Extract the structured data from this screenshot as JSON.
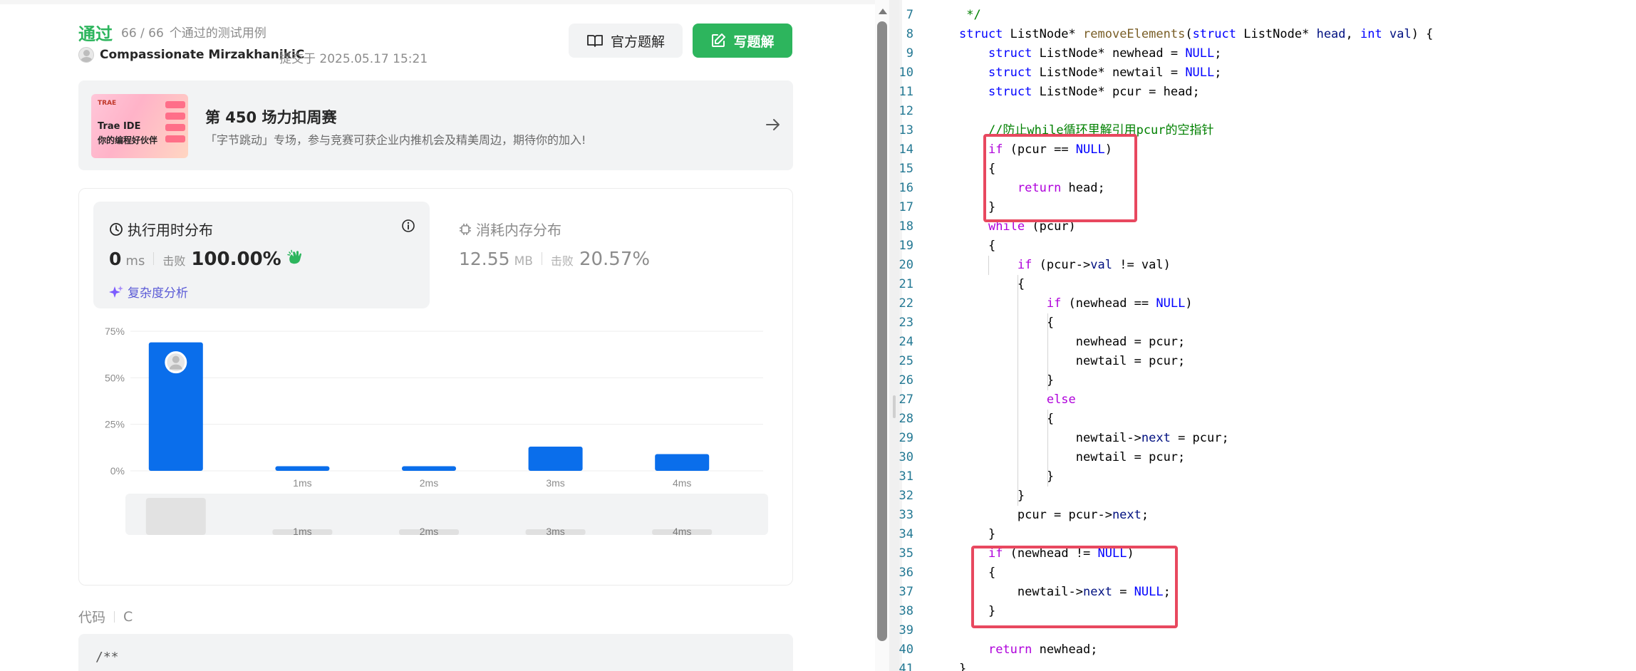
{
  "left": {
    "status": "通过",
    "passed": "66 / 66",
    "passed_suffix": "个通过的测试用例",
    "author": "Compassionate MirzakhanikiC",
    "submitted": "提交于 2025.05.17 15:21",
    "btn_official": "官方题解",
    "btn_write": "写题解",
    "banner": {
      "img_brand": "TRAE",
      "img_line1": "Trae IDE",
      "img_line2": "你的编程好伙伴",
      "title": "第 450 场力扣周赛",
      "subtitle": "「字节跳动」专场，参与竞赛可获企业内推机会及精美周边，期待你的加入!"
    },
    "runtime": {
      "title": "执行用时分布",
      "value": "0",
      "unit": "ms",
      "beat_label": "击败",
      "beat_pct": "100.00%",
      "analysis": "复杂度分析"
    },
    "memory": {
      "title": "消耗内存分布",
      "value": "12.55",
      "unit": "MB",
      "beat_label": "击败",
      "beat_pct": "20.57%"
    },
    "code_label": "代码",
    "code_lang": "C",
    "code_preview": "/**"
  },
  "chart_data": {
    "type": "bar",
    "categories": [
      "",
      "1ms",
      "2ms",
      "3ms",
      "4ms"
    ],
    "values": [
      69,
      2.5,
      2.5,
      13,
      9
    ],
    "yticks": [
      "75%",
      "50%",
      "25%",
      "0%"
    ],
    "ylim": [
      0,
      75
    ],
    "bar_color": "#0a6eeb",
    "highlighted_category_index": 0,
    "grid": true
  },
  "editor": {
    "lines": [
      {
        "n": "7",
        "segs": [
          {
            "t": " */",
            "c": "cm"
          }
        ]
      },
      {
        "n": "8",
        "segs": [
          {
            "t": "struct",
            "c": "kw"
          },
          {
            "t": " ListNode* ",
            "c": "plain"
          },
          {
            "t": "removeElements",
            "c": "fn"
          },
          {
            "t": "(",
            "c": "plain"
          },
          {
            "t": "struct",
            "c": "kw"
          },
          {
            "t": " ListNode* ",
            "c": "plain"
          },
          {
            "t": "head",
            "c": "var"
          },
          {
            "t": ", ",
            "c": "plain"
          },
          {
            "t": "int",
            "c": "kw"
          },
          {
            "t": " ",
            "c": "plain"
          },
          {
            "t": "val",
            "c": "var"
          },
          {
            "t": ") {",
            "c": "plain"
          }
        ]
      },
      {
        "n": "9",
        "segs": [
          {
            "t": "    ",
            "c": "plain"
          },
          {
            "t": "struct",
            "c": "kw"
          },
          {
            "t": " ListNode* newhead = ",
            "c": "plain"
          },
          {
            "t": "NULL",
            "c": "kw"
          },
          {
            "t": ";",
            "c": "plain"
          }
        ]
      },
      {
        "n": "10",
        "segs": [
          {
            "t": "    ",
            "c": "plain"
          },
          {
            "t": "struct",
            "c": "kw"
          },
          {
            "t": " ListNode* newtail = ",
            "c": "plain"
          },
          {
            "t": "NULL",
            "c": "kw"
          },
          {
            "t": ";",
            "c": "plain"
          }
        ]
      },
      {
        "n": "11",
        "segs": [
          {
            "t": "    ",
            "c": "plain"
          },
          {
            "t": "struct",
            "c": "kw"
          },
          {
            "t": " ListNode* pcur = head;",
            "c": "plain"
          }
        ]
      },
      {
        "n": "12",
        "segs": []
      },
      {
        "n": "13",
        "segs": [
          {
            "t": "    //防止while循环里解引用pcur的空指针",
            "c": "cm"
          }
        ]
      },
      {
        "n": "14",
        "segs": [
          {
            "t": "    ",
            "c": "plain"
          },
          {
            "t": "if",
            "c": "ctl"
          },
          {
            "t": " (pcur == ",
            "c": "plain"
          },
          {
            "t": "NULL",
            "c": "kw"
          },
          {
            "t": ")",
            "c": "plain"
          }
        ]
      },
      {
        "n": "15",
        "segs": [
          {
            "t": "    {",
            "c": "plain"
          }
        ]
      },
      {
        "n": "16",
        "segs": [
          {
            "t": "        ",
            "c": "plain"
          },
          {
            "t": "return",
            "c": "ctl"
          },
          {
            "t": " head;",
            "c": "plain"
          }
        ]
      },
      {
        "n": "17",
        "segs": [
          {
            "t": "    }",
            "c": "plain"
          }
        ]
      },
      {
        "n": "18",
        "segs": [
          {
            "t": "    ",
            "c": "plain"
          },
          {
            "t": "while",
            "c": "ctl"
          },
          {
            "t": " (pcur)",
            "c": "plain"
          }
        ]
      },
      {
        "n": "19",
        "segs": [
          {
            "t": "    {",
            "c": "plain"
          }
        ]
      },
      {
        "n": "20",
        "segs": [
          {
            "t": "        ",
            "c": "plain"
          },
          {
            "t": "if",
            "c": "ctl"
          },
          {
            "t": " (pcur->",
            "c": "plain"
          },
          {
            "t": "val",
            "c": "var"
          },
          {
            "t": " != val)",
            "c": "plain"
          }
        ]
      },
      {
        "n": "21",
        "segs": [
          {
            "t": "        {",
            "c": "plain"
          }
        ]
      },
      {
        "n": "22",
        "segs": [
          {
            "t": "            ",
            "c": "plain"
          },
          {
            "t": "if",
            "c": "ctl"
          },
          {
            "t": " (newhead == ",
            "c": "plain"
          },
          {
            "t": "NULL",
            "c": "kw"
          },
          {
            "t": ")",
            "c": "plain"
          }
        ]
      },
      {
        "n": "23",
        "segs": [
          {
            "t": "            {",
            "c": "plain"
          }
        ]
      },
      {
        "n": "24",
        "segs": [
          {
            "t": "                newhead = pcur;",
            "c": "plain"
          }
        ]
      },
      {
        "n": "25",
        "segs": [
          {
            "t": "                newtail = pcur;",
            "c": "plain"
          }
        ]
      },
      {
        "n": "26",
        "segs": [
          {
            "t": "            }",
            "c": "plain"
          }
        ]
      },
      {
        "n": "27",
        "segs": [
          {
            "t": "            ",
            "c": "plain"
          },
          {
            "t": "else",
            "c": "ctl"
          }
        ]
      },
      {
        "n": "28",
        "segs": [
          {
            "t": "            {",
            "c": "plain"
          }
        ]
      },
      {
        "n": "29",
        "segs": [
          {
            "t": "                newtail->",
            "c": "plain"
          },
          {
            "t": "next",
            "c": "var"
          },
          {
            "t": " = pcur;",
            "c": "plain"
          }
        ]
      },
      {
        "n": "30",
        "segs": [
          {
            "t": "                newtail = pcur;",
            "c": "plain"
          }
        ]
      },
      {
        "n": "31",
        "segs": [
          {
            "t": "            }",
            "c": "plain"
          }
        ]
      },
      {
        "n": "32",
        "segs": [
          {
            "t": "        }",
            "c": "plain"
          }
        ]
      },
      {
        "n": "33",
        "segs": [
          {
            "t": "        pcur = pcur->",
            "c": "plain"
          },
          {
            "t": "next",
            "c": "var"
          },
          {
            "t": ";",
            "c": "plain"
          }
        ]
      },
      {
        "n": "34",
        "segs": [
          {
            "t": "    }",
            "c": "plain"
          }
        ]
      },
      {
        "n": "35",
        "segs": [
          {
            "t": "    ",
            "c": "plain"
          },
          {
            "t": "if",
            "c": "ctl"
          },
          {
            "t": " (newhead != ",
            "c": "plain"
          },
          {
            "t": "NULL",
            "c": "kw"
          },
          {
            "t": ")",
            "c": "plain"
          }
        ]
      },
      {
        "n": "36",
        "segs": [
          {
            "t": "    {",
            "c": "plain"
          }
        ]
      },
      {
        "n": "37",
        "segs": [
          {
            "t": "        newtail->",
            "c": "plain"
          },
          {
            "t": "next",
            "c": "var"
          },
          {
            "t": " = ",
            "c": "plain"
          },
          {
            "t": "NULL",
            "c": "kw"
          },
          {
            "t": ";",
            "c": "plain"
          }
        ]
      },
      {
        "n": "38",
        "segs": [
          {
            "t": "    }",
            "c": "plain"
          }
        ]
      },
      {
        "n": "39",
        "segs": []
      },
      {
        "n": "40",
        "segs": [
          {
            "t": "    ",
            "c": "plain"
          },
          {
            "t": "return",
            "c": "ctl"
          },
          {
            "t": " newhead;",
            "c": "plain"
          }
        ]
      },
      {
        "n": "41",
        "segs": [
          {
            "t": "}",
            "c": "plain"
          }
        ]
      }
    ],
    "highlight_color": "#e8485f"
  }
}
